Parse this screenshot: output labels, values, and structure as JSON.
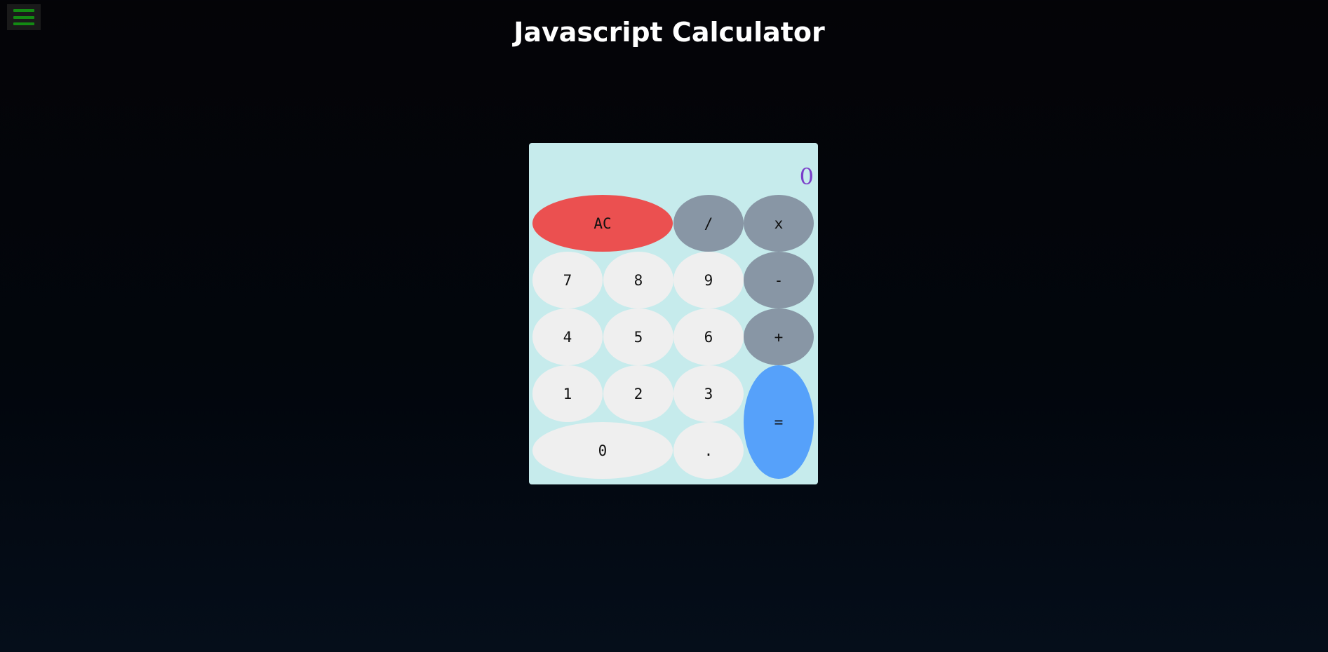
{
  "header": {
    "title": "Javascript Calculator",
    "menu_icon": "hamburger-icon"
  },
  "calculator": {
    "display": "0",
    "keys": {
      "clear": "AC",
      "divide": "/",
      "multiply": "x",
      "seven": "7",
      "eight": "8",
      "nine": "9",
      "subtract": "-",
      "four": "4",
      "five": "5",
      "six": "6",
      "add": "+",
      "one": "1",
      "two": "2",
      "three": "3",
      "equals": "=",
      "zero": "0",
      "decimal": "."
    }
  },
  "colors": {
    "page_background": "#040407",
    "calculator_background": "#c6ebec",
    "display_text": "#7a3ec9",
    "number_key": "#efefef",
    "operator_key": "#8896a5",
    "clear_key": "#eb5050",
    "equals_key": "#56a1fa",
    "menu_icon": "#138a13"
  }
}
